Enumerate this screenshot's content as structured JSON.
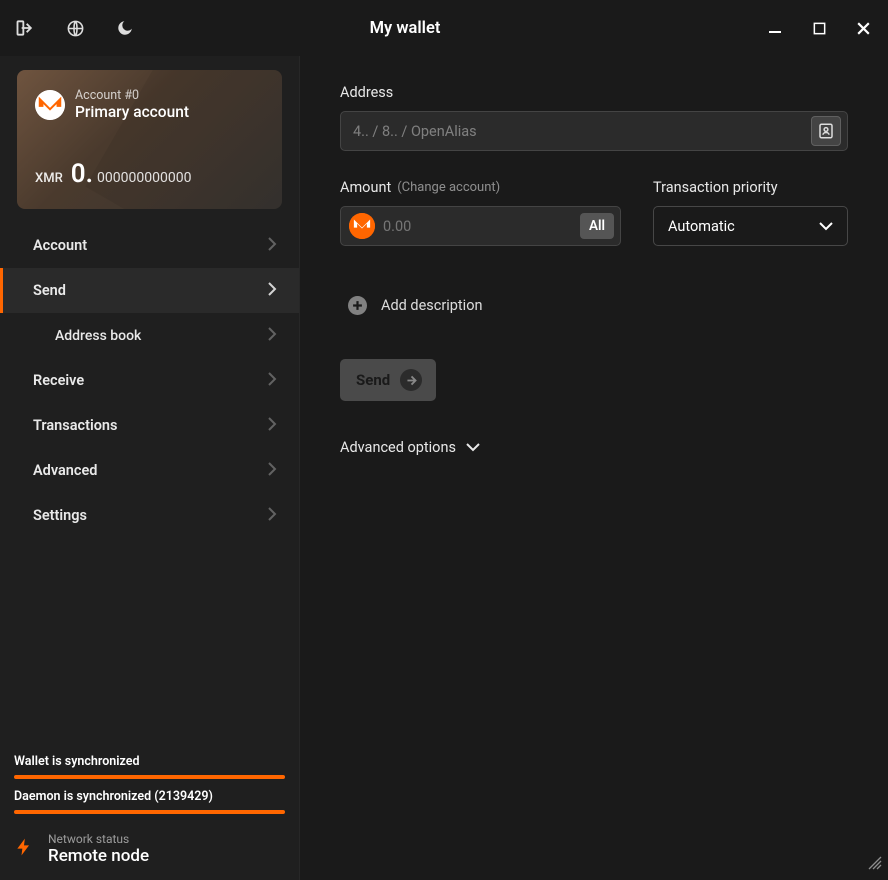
{
  "titlebar": {
    "title": "My wallet"
  },
  "account_card": {
    "label": "Account #0",
    "name": "Primary account",
    "currency": "XMR",
    "balance_int": "0.",
    "balance_dec": "000000000000"
  },
  "nav": {
    "account": "Account",
    "send": "Send",
    "address_book": "Address book",
    "receive": "Receive",
    "transactions": "Transactions",
    "advanced": "Advanced",
    "settings": "Settings"
  },
  "sync": {
    "wallet": "Wallet is synchronized",
    "daemon": "Daemon is synchronized (2139429)"
  },
  "network": {
    "label": "Network status",
    "value": "Remote node"
  },
  "form": {
    "address_label": "Address",
    "address_placeholder": "4.. / 8.. / OpenAlias",
    "amount_label": "Amount",
    "amount_sub": "(Change account)",
    "amount_placeholder": "0.00",
    "all_label": "All",
    "priority_label": "Transaction priority",
    "priority_value": "Automatic",
    "add_description": "Add description",
    "send_button": "Send",
    "advanced_options": "Advanced options"
  }
}
